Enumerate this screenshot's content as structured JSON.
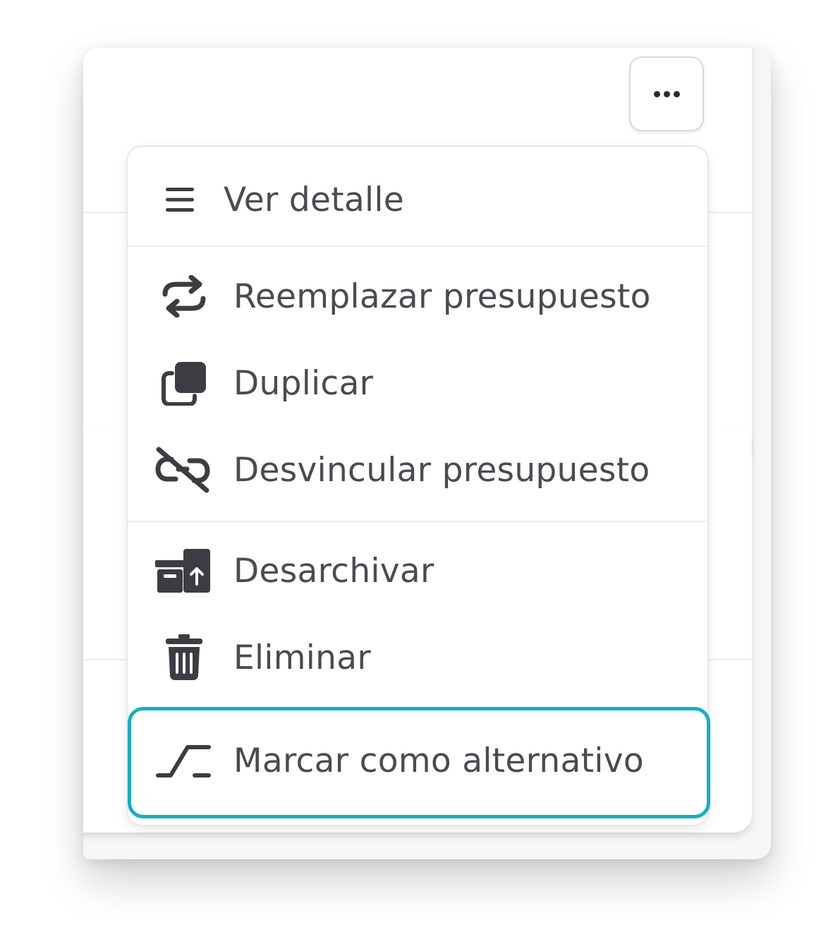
{
  "more_button": {
    "icon": "more-horizontal-icon"
  },
  "menu": {
    "items": [
      {
        "label": "Ver detalle",
        "icon": "list-icon"
      },
      {
        "label": "Reemplazar presupuesto",
        "icon": "swap-arrows-icon"
      },
      {
        "label": "Duplicar",
        "icon": "copy-icon"
      },
      {
        "label": "Desvincular presupuesto",
        "icon": "unlink-icon"
      },
      {
        "label": "Desarchivar",
        "icon": "unarchive-icon"
      },
      {
        "label": "Eliminar",
        "icon": "trash-icon"
      },
      {
        "label": "Marcar como alternativo",
        "icon": "alternative-step-icon"
      }
    ]
  },
  "colors": {
    "icon": "#3c3c42",
    "text": "#4a4a50",
    "highlight": "#17aec3",
    "border": "#e7e7ea"
  }
}
